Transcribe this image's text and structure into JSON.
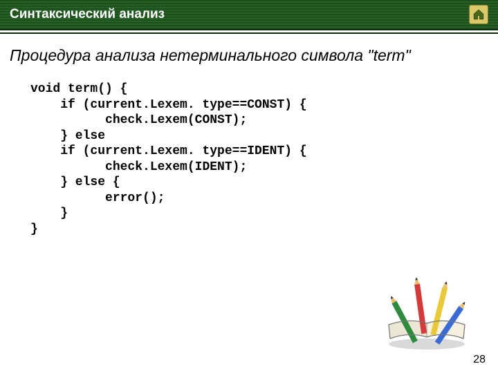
{
  "header": {
    "title": "Синтаксический анализ",
    "home_icon": "home-icon"
  },
  "subtitle": "Процедура анализа нетерминального символа \"term\"",
  "code": {
    "l1": "void term() {",
    "l2": "    if (current.Lexem. type==CONST) {",
    "l3": "          check.Lexem(CONST);",
    "l4": "    } else",
    "l5": "    if (current.Lexem. type==IDENT) {",
    "l6": "          check.Lexem(IDENT);",
    "l7": "    } else {",
    "l8": "          error();",
    "l9": "    }",
    "l10": "}"
  },
  "page_number": "28"
}
